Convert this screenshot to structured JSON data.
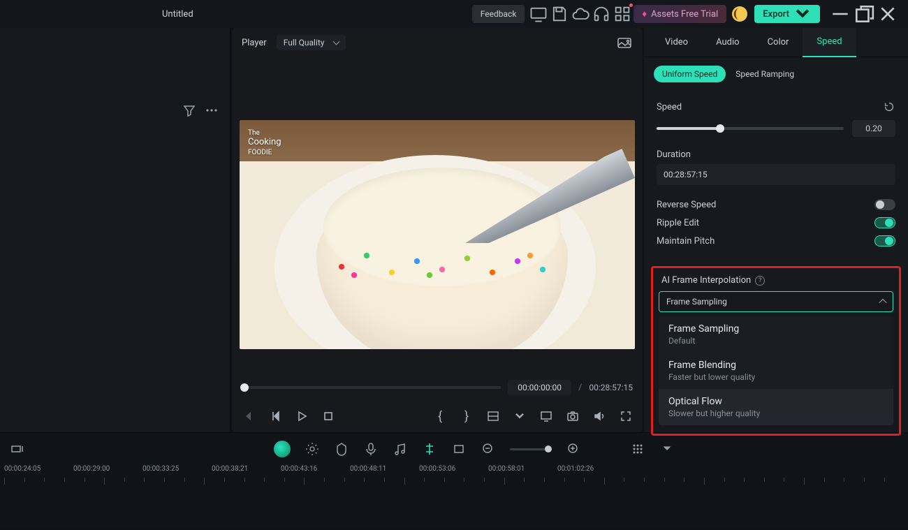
{
  "titlebar": {
    "title": "Untitled",
    "feedback": "Feedback",
    "assets": "Assets Free Trial",
    "export": "Export"
  },
  "center": {
    "player_label": "Player",
    "quality": "Full Quality",
    "current_time": "00:00:00:00",
    "total_time": "00:28:57:15",
    "logo_the": "The",
    "logo_cooking": "Cooking",
    "logo_foodie": "FOODIE"
  },
  "right": {
    "tabs": {
      "video": "Video",
      "audio": "Audio",
      "color": "Color",
      "speed": "Speed"
    },
    "subtabs": {
      "uniform": "Uniform Speed",
      "ramping": "Speed Ramping"
    },
    "speed_label": "Speed",
    "speed_value": "0.20",
    "duration_label": "Duration",
    "duration_value": "00:28:57:15",
    "reverse_label": "Reverse Speed",
    "ripple_label": "Ripple Edit",
    "pitch_label": "Maintain Pitch",
    "ai_label": "AI Frame Interpolation",
    "select_value": "Frame Sampling",
    "options": [
      {
        "title": "Frame Sampling",
        "sub": "Default"
      },
      {
        "title": "Frame Blending",
        "sub": "Faster but lower quality"
      },
      {
        "title": "Optical Flow",
        "sub": "Slower but higher quality"
      }
    ]
  },
  "timeline": {
    "marks": [
      "00:00:24:05",
      "00:00:29:00",
      "00:00:33:25",
      "00:00:38:21",
      "00:00:43:16",
      "00:00:48:11",
      "00:00:53:06",
      "00:00:58:01",
      "00:01:02:26"
    ]
  }
}
